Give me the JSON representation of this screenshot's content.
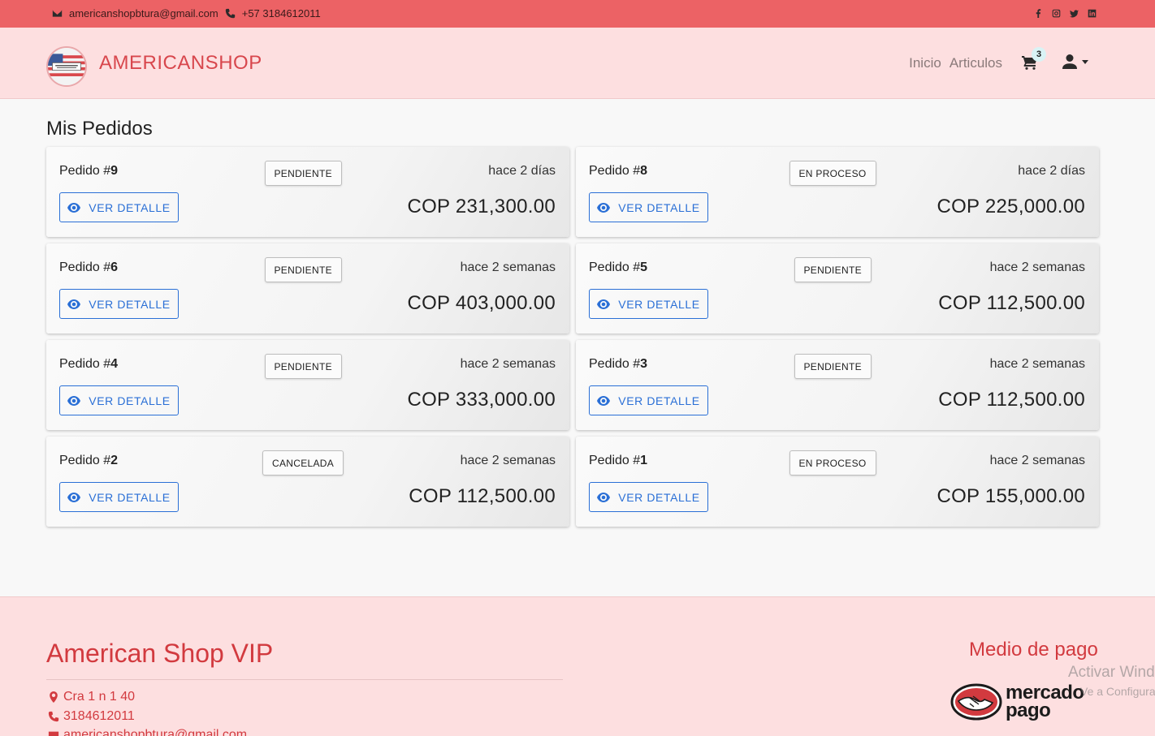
{
  "topbar": {
    "email": "americanshopbtura@gmail.com",
    "phone": "+57 3184612011",
    "social_icons": [
      "facebook-icon",
      "instagram-icon",
      "twitter-icon",
      "linkedin-icon"
    ],
    "background": "#ec6265"
  },
  "navbar": {
    "brand": "AMERICANSHOP",
    "links": [
      "Inicio",
      "Articulos"
    ],
    "cart_count": "3",
    "background": "#fddfe0"
  },
  "main": {
    "title": "Mis Pedidos",
    "detail_label": "VER DETALLE",
    "order_prefix": "Pedido #",
    "orders": [
      {
        "number": "9",
        "status": "PENDIENTE",
        "time": "hace 2 días",
        "amount": "COP 231,300.00"
      },
      {
        "number": "8",
        "status": "EN PROCESO",
        "time": "hace 2 días",
        "amount": "COP 225,000.00"
      },
      {
        "number": "6",
        "status": "PENDIENTE",
        "time": "hace 2 semanas",
        "amount": "COP 403,000.00"
      },
      {
        "number": "5",
        "status": "PENDIENTE",
        "time": "hace 2 semanas",
        "amount": "COP 112,500.00"
      },
      {
        "number": "4",
        "status": "PENDIENTE",
        "time": "hace 2 semanas",
        "amount": "COP 333,000.00"
      },
      {
        "number": "3",
        "status": "PENDIENTE",
        "time": "hace 2 semanas",
        "amount": "COP 112,500.00"
      },
      {
        "number": "2",
        "status": "CANCELADA",
        "time": "hace 2 semanas",
        "amount": "COP 112,500.00"
      },
      {
        "number": "1",
        "status": "EN PROCESO",
        "time": "hace 2 semanas",
        "amount": "COP 155,000.00"
      }
    ],
    "accent": "#2a6fd6"
  },
  "footer": {
    "title": "American Shop VIP",
    "address": "Cra 1 n 1 40",
    "phone": "3184612011",
    "email": "americanshopbtura@gmail.com",
    "payment_title": "Medio de pago",
    "payment_logo_line1": "mercado",
    "payment_logo_line2": "pago",
    "accent": "#d23a3f"
  },
  "os_watermark": {
    "line1": "Activar Windows",
    "line2": "Ve a Configuración"
  }
}
